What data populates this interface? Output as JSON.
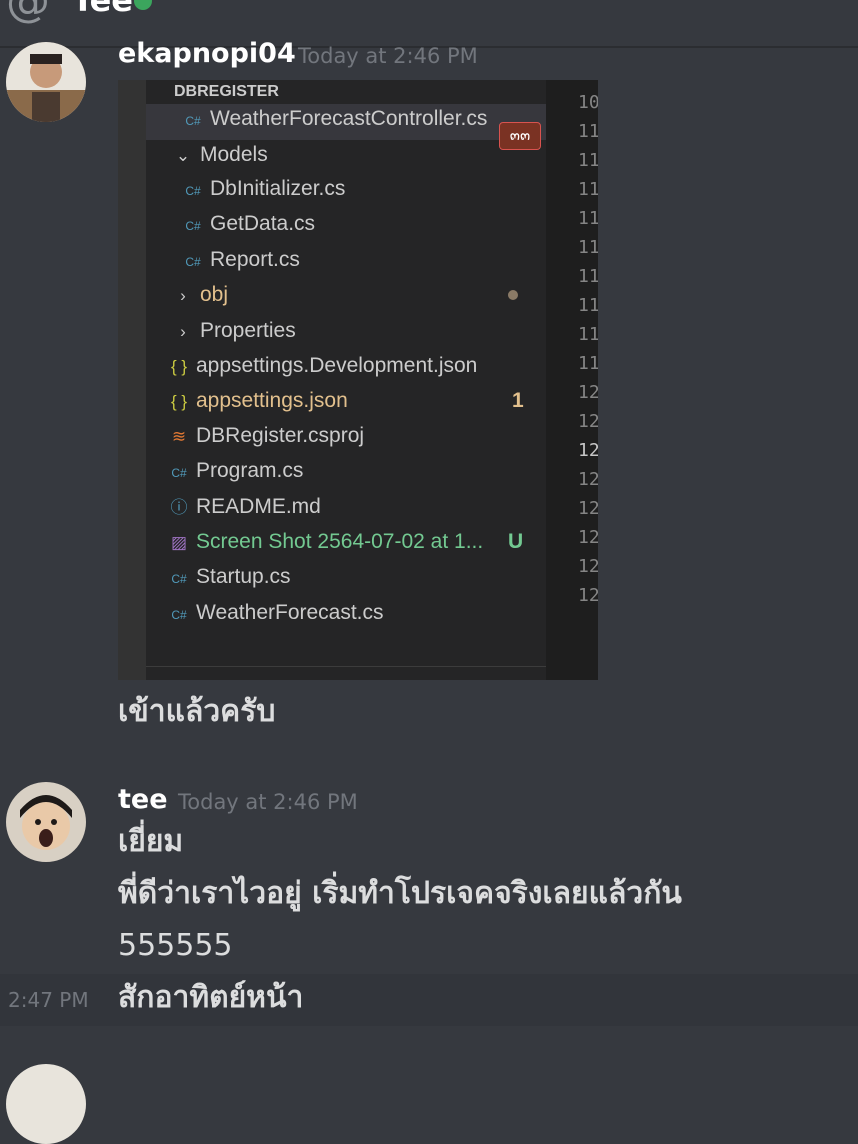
{
  "header": {
    "at_icon": "@",
    "channel_name": "Tee"
  },
  "messages": [
    {
      "username": "ekapnopi04",
      "timestamp": "Today at 2:46 PM",
      "text": "เข้าแล้วครับ"
    },
    {
      "username": "tee",
      "timestamp": "Today at 2:46 PM",
      "lines": [
        "เยี่ยม",
        "พี่ดีว่าเราไวอยู่ เริ่มทำโปรเจคจริงเลยแล้วกัน",
        "555555"
      ]
    },
    {
      "hover_time": "2:47 PM",
      "text": "สักอาทิตย์หน้า"
    }
  ],
  "explorer": {
    "section_title": "DBREGISTER",
    "badge": "๓๓",
    "items": [
      {
        "label": "WeatherForecastController.cs",
        "icon": "csharp-icon"
      },
      {
        "label": "Models",
        "icon": "chevron-down-icon"
      },
      {
        "label": "DbInitializer.cs",
        "icon": "csharp-icon"
      },
      {
        "label": "GetData.cs",
        "icon": "csharp-icon"
      },
      {
        "label": "Report.cs",
        "icon": "csharp-icon"
      },
      {
        "label": "obj",
        "icon": "chevron-right-icon"
      },
      {
        "label": "Properties",
        "icon": "chevron-right-icon"
      },
      {
        "label": "appsettings.Development.json",
        "icon": "json-icon"
      },
      {
        "label": "appsettings.json",
        "icon": "json-icon",
        "status": "1"
      },
      {
        "label": "DBRegister.csproj",
        "icon": "rss-icon"
      },
      {
        "label": "Program.cs",
        "icon": "csharp-icon"
      },
      {
        "label": "README.md",
        "icon": "info-icon"
      },
      {
        "label": "Screen Shot 2564-07-02 at 1...",
        "icon": "image-icon",
        "status": "U"
      },
      {
        "label": "Startup.cs",
        "icon": "csharp-icon"
      },
      {
        "label": "WeatherForecast.cs",
        "icon": "csharp-icon"
      }
    ],
    "line_numbers": [
      "10",
      "11",
      "11",
      "11",
      "11",
      "11",
      "11",
      "11",
      "11",
      "11",
      "12",
      "12",
      "12",
      "12",
      "12",
      "12",
      "12",
      "12"
    ]
  },
  "colors": {
    "background": "#36393f",
    "online": "#3ba55d",
    "json_yellow": "#e2c08d",
    "untracked_green": "#73c991"
  }
}
